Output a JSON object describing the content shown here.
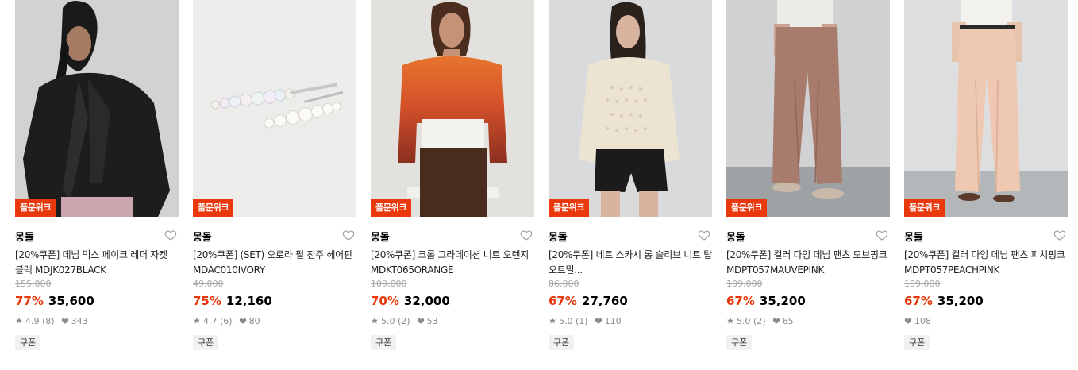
{
  "products": [
    {
      "badge": "폴문위크",
      "brand": "몽돌",
      "name": "[20%쿠폰] 데님 믹스 페이크 레더 자켓 블랙 MDJK027BLACK",
      "original_price": "155,000",
      "discount": "77%",
      "price": "35,600",
      "rating": "4.9",
      "reviews": "(8)",
      "likes": "343",
      "chip": "쿠폰",
      "image_desc": "black-leather-jacket"
    },
    {
      "badge": "폴문위크",
      "brand": "몽돌",
      "name": "[20%쿠폰] (SET) 오로라 펄 진주 헤어핀 MDAC010IVORY",
      "original_price": "49,000",
      "discount": "75%",
      "price": "12,160",
      "rating": "4.7",
      "reviews": "(6)",
      "likes": "80",
      "chip": "쿠폰",
      "image_desc": "pearl-hairpins"
    },
    {
      "badge": "폴문위크",
      "brand": "몽돌",
      "name": "[20%쿠폰] 크롭 그라데이션 니트 오렌지 MDKT065ORANGE",
      "original_price": "109,000",
      "discount": "70%",
      "price": "32,000",
      "rating": "5.0",
      "reviews": "(2)",
      "likes": "53",
      "chip": "쿠폰",
      "image_desc": "orange-gradient-knit"
    },
    {
      "badge": "폴문위크",
      "brand": "몽돌",
      "name": "[20%쿠폰] 네트 스카시 롱 슬리브 니트 탑 오트밀...",
      "original_price": "86,000",
      "discount": "67%",
      "price": "27,760",
      "rating": "5.0",
      "reviews": "(1)",
      "likes": "110",
      "chip": "쿠폰",
      "image_desc": "oatmeal-net-knit-top"
    },
    {
      "badge": "폴문위크",
      "brand": "몽돌",
      "name": "[20%쿠폰] 컬러 다잉 데님 팬츠 모브핑크 MDPT057MAUVEPINK",
      "original_price": "109,000",
      "discount": "67%",
      "price": "35,200",
      "rating": "5.0",
      "reviews": "(2)",
      "likes": "65",
      "chip": "쿠폰",
      "image_desc": "mauve-pink-denim-pants"
    },
    {
      "badge": "폴문위크",
      "brand": "몽돌",
      "name": "[20%쿠폰] 컬러 다잉 데님 팬츠 피치핑크 MDPT057PEACHPINK",
      "original_price": "109,000",
      "discount": "67%",
      "price": "35,200",
      "rating": "",
      "reviews": "",
      "likes": "108",
      "chip": "쿠폰",
      "image_desc": "peach-pink-denim-pants"
    }
  ],
  "colors": {
    "accent": "#e8380c",
    "badge_bg": "#e8380c",
    "strike": "#a8a8a8",
    "meta": "#8a8a8a"
  },
  "icons": {
    "wishlist": "heart-outline-icon",
    "rating": "star-icon",
    "likes": "heart-filled-icon"
  }
}
